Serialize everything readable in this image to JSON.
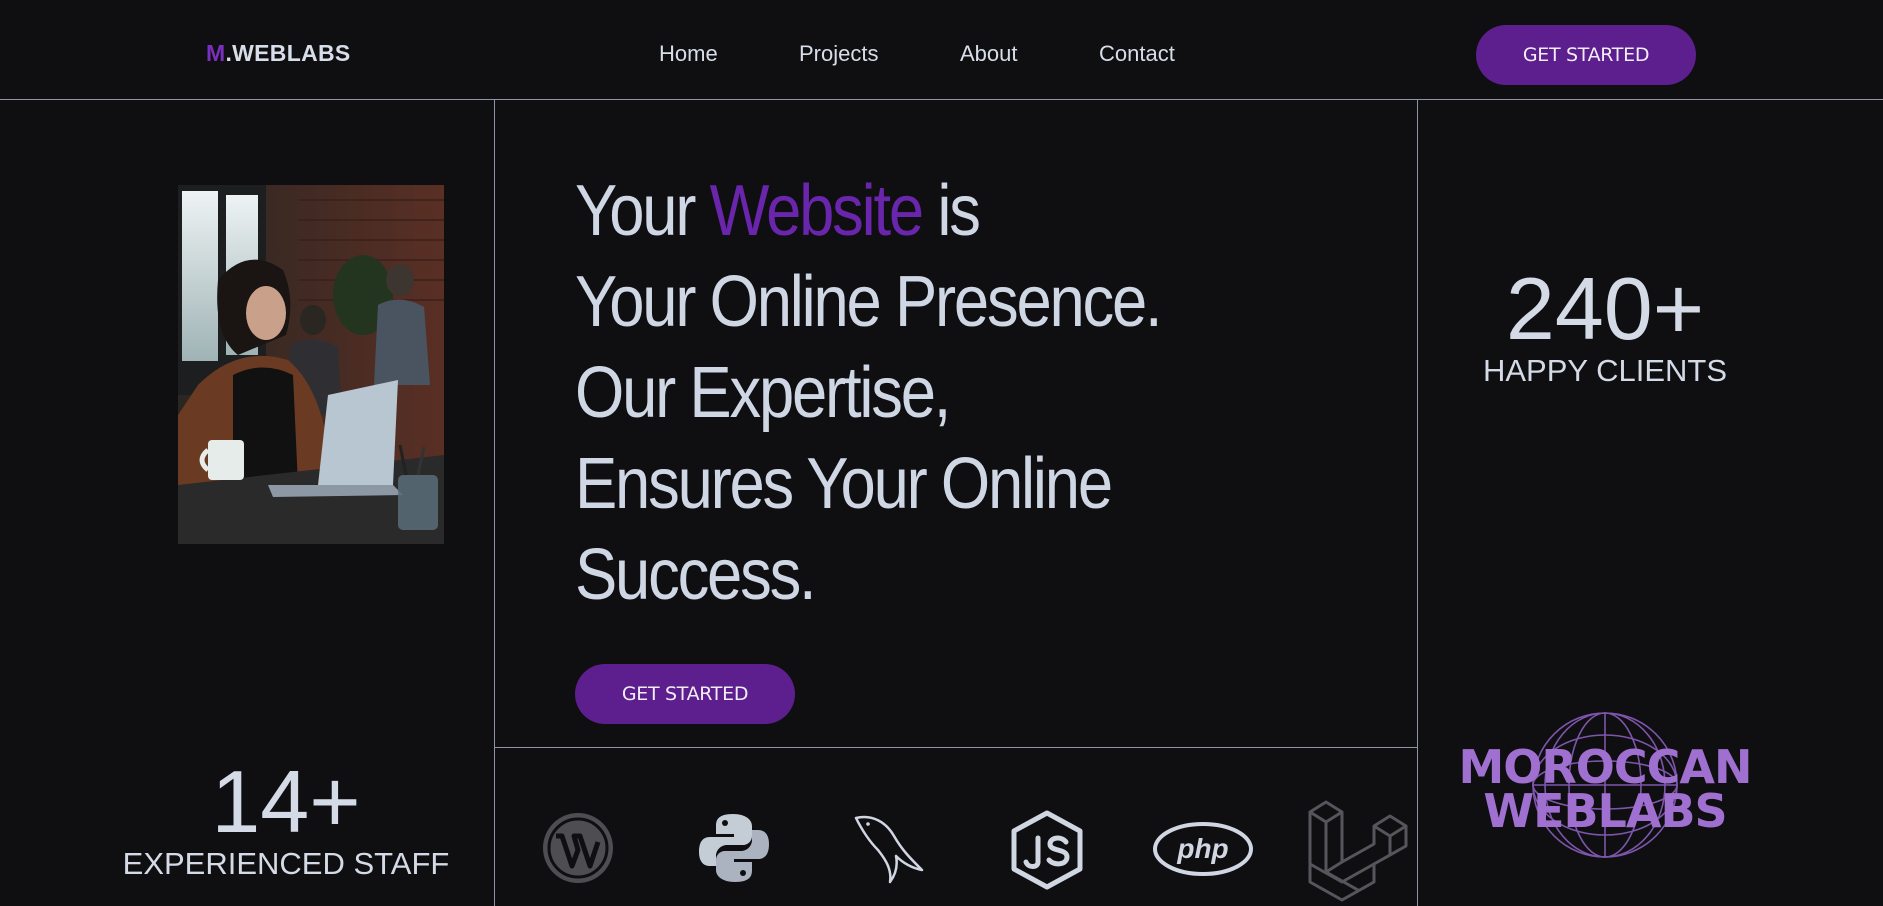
{
  "header": {
    "logo_accent": "M",
    "logo_rest": ".WEBLABS",
    "nav": [
      {
        "label": "Home"
      },
      {
        "label": "Projects"
      },
      {
        "label": "About"
      },
      {
        "label": "Contact"
      }
    ],
    "cta_label": "GET STARTED"
  },
  "hero": {
    "line1_pre": "Your ",
    "line1_highlight": "Website",
    "line1_post": " is",
    "line2": "Your Online Presence.",
    "line3": "Our Expertise,",
    "line4": "Ensures Your Online",
    "line5": "Success.",
    "cta_label": "GET STARTED"
  },
  "stats": {
    "staff": {
      "number": "14+",
      "label": "EXPERIENCED STAFF"
    },
    "clients": {
      "number": "240+",
      "label": "HAPPY CLIENTS"
    }
  },
  "tech_icons": [
    "wordpress-icon",
    "python-icon",
    "mysql-icon",
    "nodejs-icon",
    "php-icon",
    "laravel-icon"
  ],
  "brand": {
    "line1": "MOROCCAN",
    "line2": "WEBLABS"
  },
  "colors": {
    "background": "#0f0f12",
    "accent": "#6a25ad",
    "button": "#5d1e8e",
    "text": "#cfd6e4",
    "divider": "#8e93a6"
  }
}
